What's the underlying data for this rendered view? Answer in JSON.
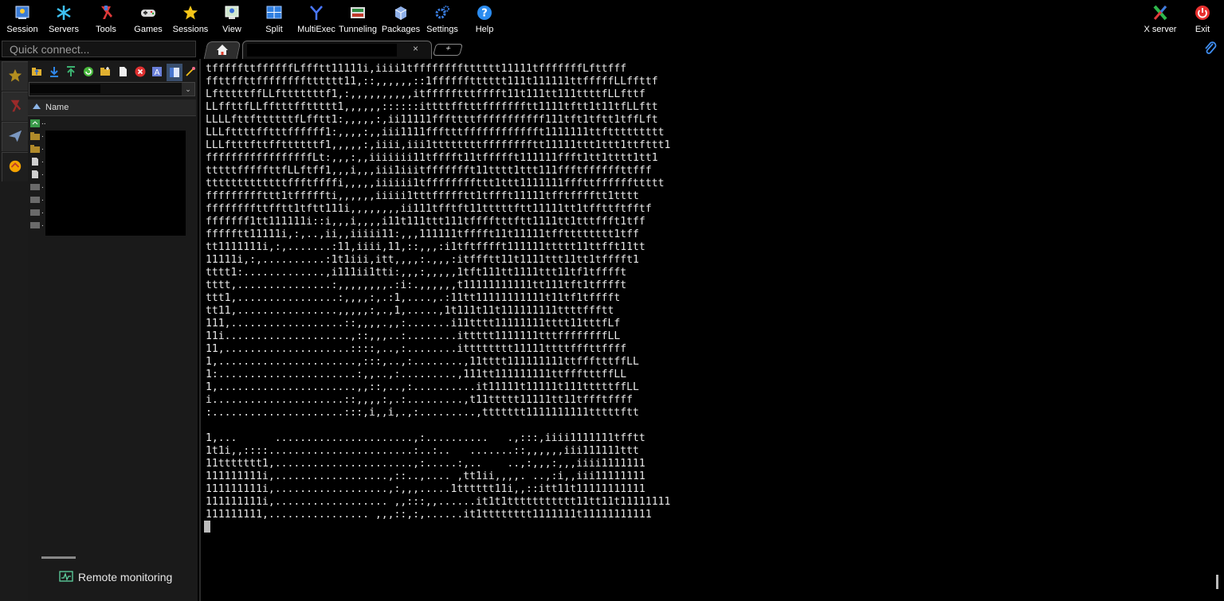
{
  "toolbar": {
    "session": "Session",
    "servers": "Servers",
    "tools": "Tools",
    "games": "Games",
    "sessions": "Sessions",
    "view": "View",
    "split": "Split",
    "multiexec": "MultiExec",
    "tunneling": "Tunneling",
    "packages": "Packages",
    "settings": "Settings",
    "help": "Help",
    "xserver": "X server",
    "exit": "Exit"
  },
  "quick_connect": {
    "placeholder": "Quick connect..."
  },
  "tabs": {
    "close_glyph": "×",
    "add_glyph": "+"
  },
  "sftp": {
    "column_name": "Name",
    "path_dropdown_glyph": "⌄",
    "files": [
      {
        "name": "..",
        "type": "parent"
      },
      {
        "name": ".",
        "type": "folder"
      },
      {
        "name": ".",
        "type": "folder"
      },
      {
        "name": ".",
        "type": "file"
      },
      {
        "name": ".",
        "type": "file"
      },
      {
        "name": ".",
        "type": "file-dark"
      },
      {
        "name": ".",
        "type": "file-dark"
      },
      {
        "name": ".",
        "type": "file-dark"
      },
      {
        "name": ".",
        "type": "file-dark"
      }
    ]
  },
  "monitoring": {
    "label": "Remote monitoring"
  },
  "terminal": {
    "lines": [
      "tfffffttffffffLffftt11111i,iiii1tfffffffftttttt11111tfffffffLfttfff",
      "ffttffttfffffffftttttt11,::,,,,,,::1fffffftttttt111t111111ttfffffLLffttf",
      "LftttttffLLftttttttf1,:,,,,,,,,,,itffffftttfffft11t111tt111ttttfLLfttf",
      "LLffttfLLfftttffttttt1,,,,,,::::::ittttfftttffffffftt1111tftt1t11tfLLftt",
      "LLLLfttfttttttfLfftt1:,,,,,:,ii11111fffttttfffffffffff111tft1tftt1tffLft",
      "LLLfttttfftttffffff1:,,,,:,,iii1111ffftttfffffffffffft1111111ttfttttttttt",
      "LLLftttfttffttttttf1,,,,,:,iiii,iii1ttttttttfffffffftt11111ttt1ttt1ttfttt1",
      "fffffffffffffffffLt:,,,:,,iiiiiii11tfffft11tffffft111111ffft1tt1tttt1tt1",
      "tttttfffffttfLLftff1,,,i,,,iii1iiitffffffft11tttt1ttt111ffftffffffttfff",
      "tttttttttttttffftffffi,,,,,iiiiii1tffffffffttt1ttt1111111fffttffffffttttt",
      "fffffffffttt1tfffffti,,,,,,iiiii1tttffffftt1tffft11111tfftfffftt1tttt",
      "ffffffffttfftt1tftt111i,,,,,,,,ii111tfftft11tttttftt11111tt1tffttftfftf",
      "fffffff1tt111111i::i,,,i,,,,i11t111ttt111tfffftttftt1111tt1tttffft1tff",
      "ffffftt11111i,:,..,ii,,iiiii11:,,,111111tfffft11t11111tfftttttttt1tff",
      "tt1111111i,:,.......:11,iiii,11,::,,,:i1tftfffft111111ttttt11ttfft11tt",
      "11111i,:,..........:1t1iii,itt,,,,:.,,,:itffftt11t1111ttt11tt1tfffft1",
      "tttt1:.............,i111ii1tti:,,,:,,,,,1tft111tt1111ttt11tf1tfffft",
      "tttt,...............:,,,,,,,,.:i:.,,,,,,t11111111111tt111tft1tfffft",
      "ttt1,................:,,,,:,.:1,....,.:11tt11111111111t11tf1tfffft",
      "tt11,................,,,,,:,.,1,.....,1t111t11t111111111ttttffftt",
      "111,..................::,,,,.,,:.......i11tttt11111111tttt11tttfLf",
      "11i....................,::,,,..:........ittttt1111111tttffffffffLL",
      "11,....................::::,..,:........itttttttt11111ttttfffttffff",
      "1,......................,:::,..,:........,11tttt111111111ttffftttffLL",
      "1:......................:,,..,:.........,111tt111111111ttffftttffLL",
      "1,......................,,::,..,:..........it11111t11111t111tttttffLL",
      "i.....................::,,,,:,.:.........,t11ttttt11111tt11tffftffff",
      ":.....................:::,i,,i,.,:.........,ttttttt1111111111tttttftt",
      "",
      "1,...      ......................,:..........   .,:::,iiii1111111tfftt",
      "1t1i,,::::.......................:..:..   .......::,,,,,,iii111111ttt",
      "11ttttttt1,......................,:.....:,..    ..,:,,,:,,,iiii1111111",
      "111111111i,..................,::..,.... ,tt1ii,,,,. ..,:i,,iii11111111",
      "111111111i,..................,:,,,.....1tttttt11i,,::itt11t11111111111",
      "111111111i,.................. ,,:::,,......it1t1ttttttttttt11tt11t11111111",
      "111111111,................ ,,,::,:,......it1tttttttt1111111t11111111111"
    ]
  }
}
